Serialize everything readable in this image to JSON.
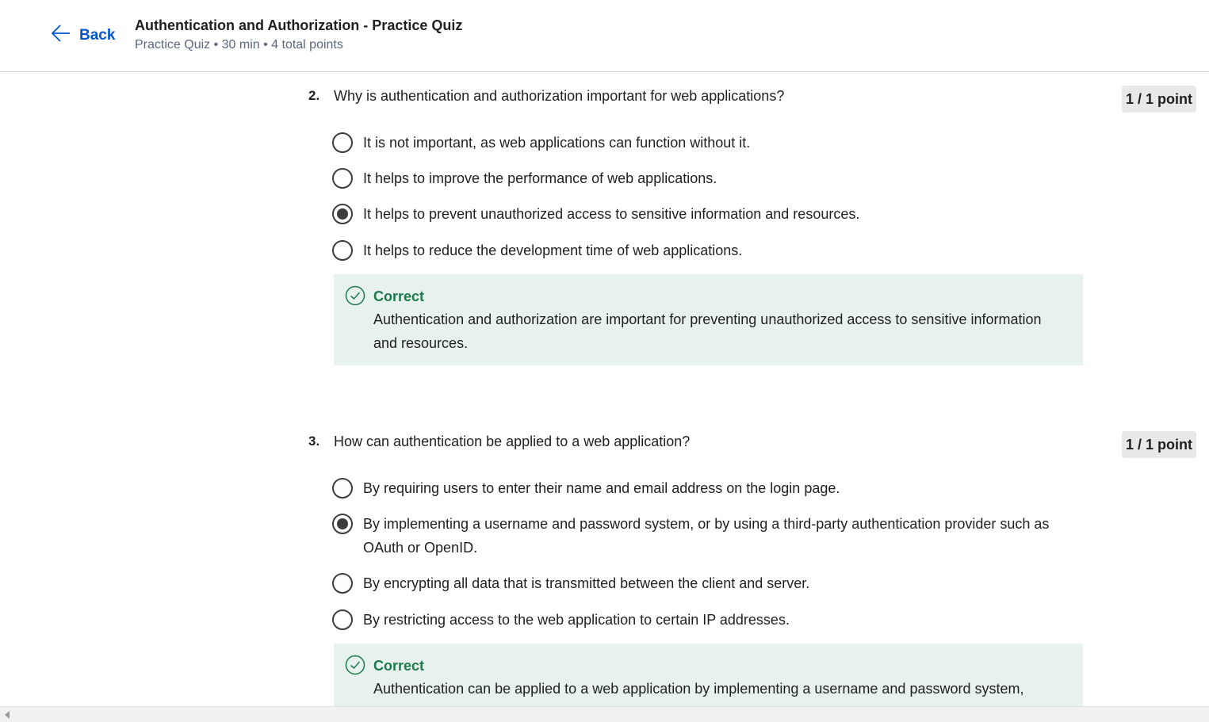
{
  "header": {
    "back_label": "Back",
    "title": "Authentication and Authorization - Practice Quiz",
    "subtitle": "Practice Quiz • 30 min • 4 total points"
  },
  "questions": [
    {
      "number": "2.",
      "text": "Why is authentication and authorization important for web applications?",
      "points": "1 / 1 point",
      "options": [
        {
          "label": "It is not important, as web applications can function without it.",
          "selected": false
        },
        {
          "label": "It helps to improve the performance of web applications.",
          "selected": false
        },
        {
          "label": "It helps to prevent unauthorized access to sensitive information and resources.",
          "selected": true
        },
        {
          "label": "It helps to reduce the development time of web applications.",
          "selected": false
        }
      ],
      "feedback": {
        "title": "Correct",
        "text": "Authentication and authorization are important for preventing unauthorized access to sensitive information and resources."
      }
    },
    {
      "number": "3.",
      "text": "How can authentication be applied to a web application?",
      "points": "1 / 1 point",
      "options": [
        {
          "label": "By requiring users to enter their name and email address on the login page.",
          "selected": false
        },
        {
          "label": "By implementing a username and password system, or by using a third-party authentication provider such as OAuth or OpenID.",
          "selected": true
        },
        {
          "label": "By encrypting all data that is transmitted between the client and server.",
          "selected": false
        },
        {
          "label": "By restricting access to the web application to certain IP addresses.",
          "selected": false
        }
      ],
      "feedback": {
        "title": "Correct",
        "text": "Authentication can be applied to a web application by implementing a username and password system,"
      }
    }
  ],
  "colors": {
    "link": "#0056d2",
    "correct": "#1e7a4b",
    "feedback_bg": "#e7f2ee"
  }
}
